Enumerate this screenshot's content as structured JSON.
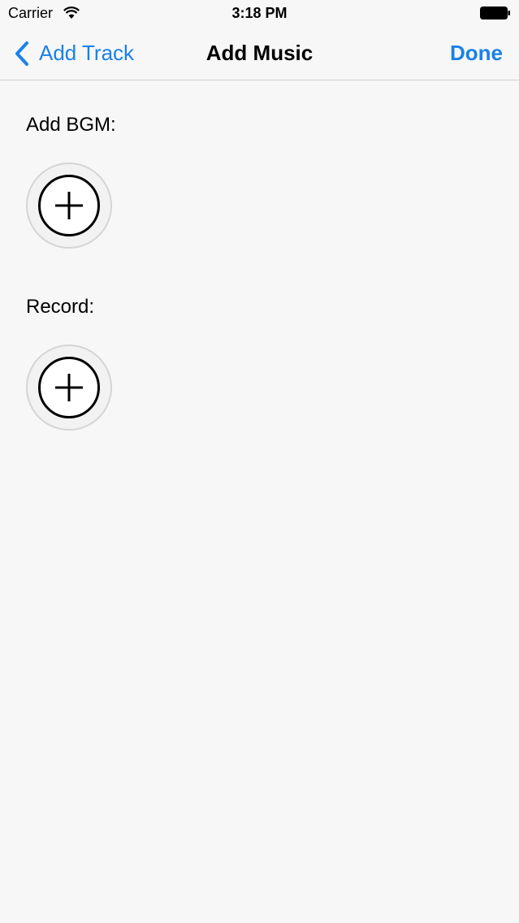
{
  "status_bar": {
    "carrier": "Carrier",
    "time": "3:18 PM",
    "wifi_icon": "wifi-icon",
    "battery_icon": "battery-icon"
  },
  "nav": {
    "back_label": "Add Track",
    "back_icon": "chevron-left-icon",
    "title": "Add Music",
    "done_label": "Done",
    "accent_color": "#1a82e6"
  },
  "sections": {
    "bgm": {
      "label": "Add BGM:",
      "button_icon": "plus-circle-icon"
    },
    "record": {
      "label": "Record:",
      "button_icon": "plus-circle-icon"
    }
  }
}
